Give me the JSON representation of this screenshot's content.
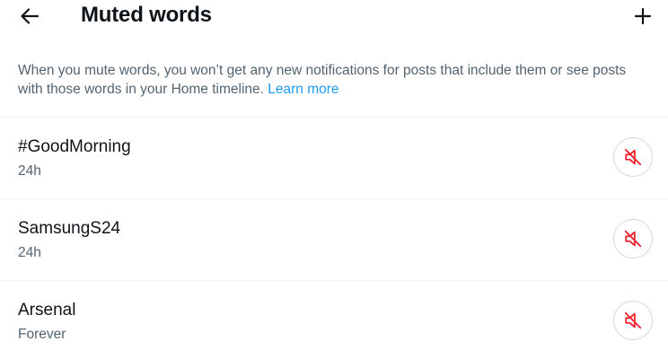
{
  "header": {
    "title": "Muted words",
    "back_icon": "arrow-left-icon",
    "add_icon": "plus-icon"
  },
  "description": {
    "text": "When you mute words, you won’t get any new notifications for posts that include them or see posts with those words in your Home timeline.",
    "link_label": "Learn more"
  },
  "muted_words": [
    {
      "word": "#GoodMorning",
      "duration": "24h",
      "action_icon": "speaker-muted-icon"
    },
    {
      "word": "SamsungS24",
      "duration": "24h",
      "action_icon": "speaker-muted-icon"
    },
    {
      "word": "Arsenal",
      "duration": "Forever",
      "action_icon": "speaker-muted-icon"
    }
  ],
  "colors": {
    "text_primary": "#0f1419",
    "text_secondary": "#536471",
    "link": "#1d9bf0",
    "unmute_icon": "#f4212e",
    "divider": "#eff3f4",
    "button_border": "#cfd9de"
  }
}
